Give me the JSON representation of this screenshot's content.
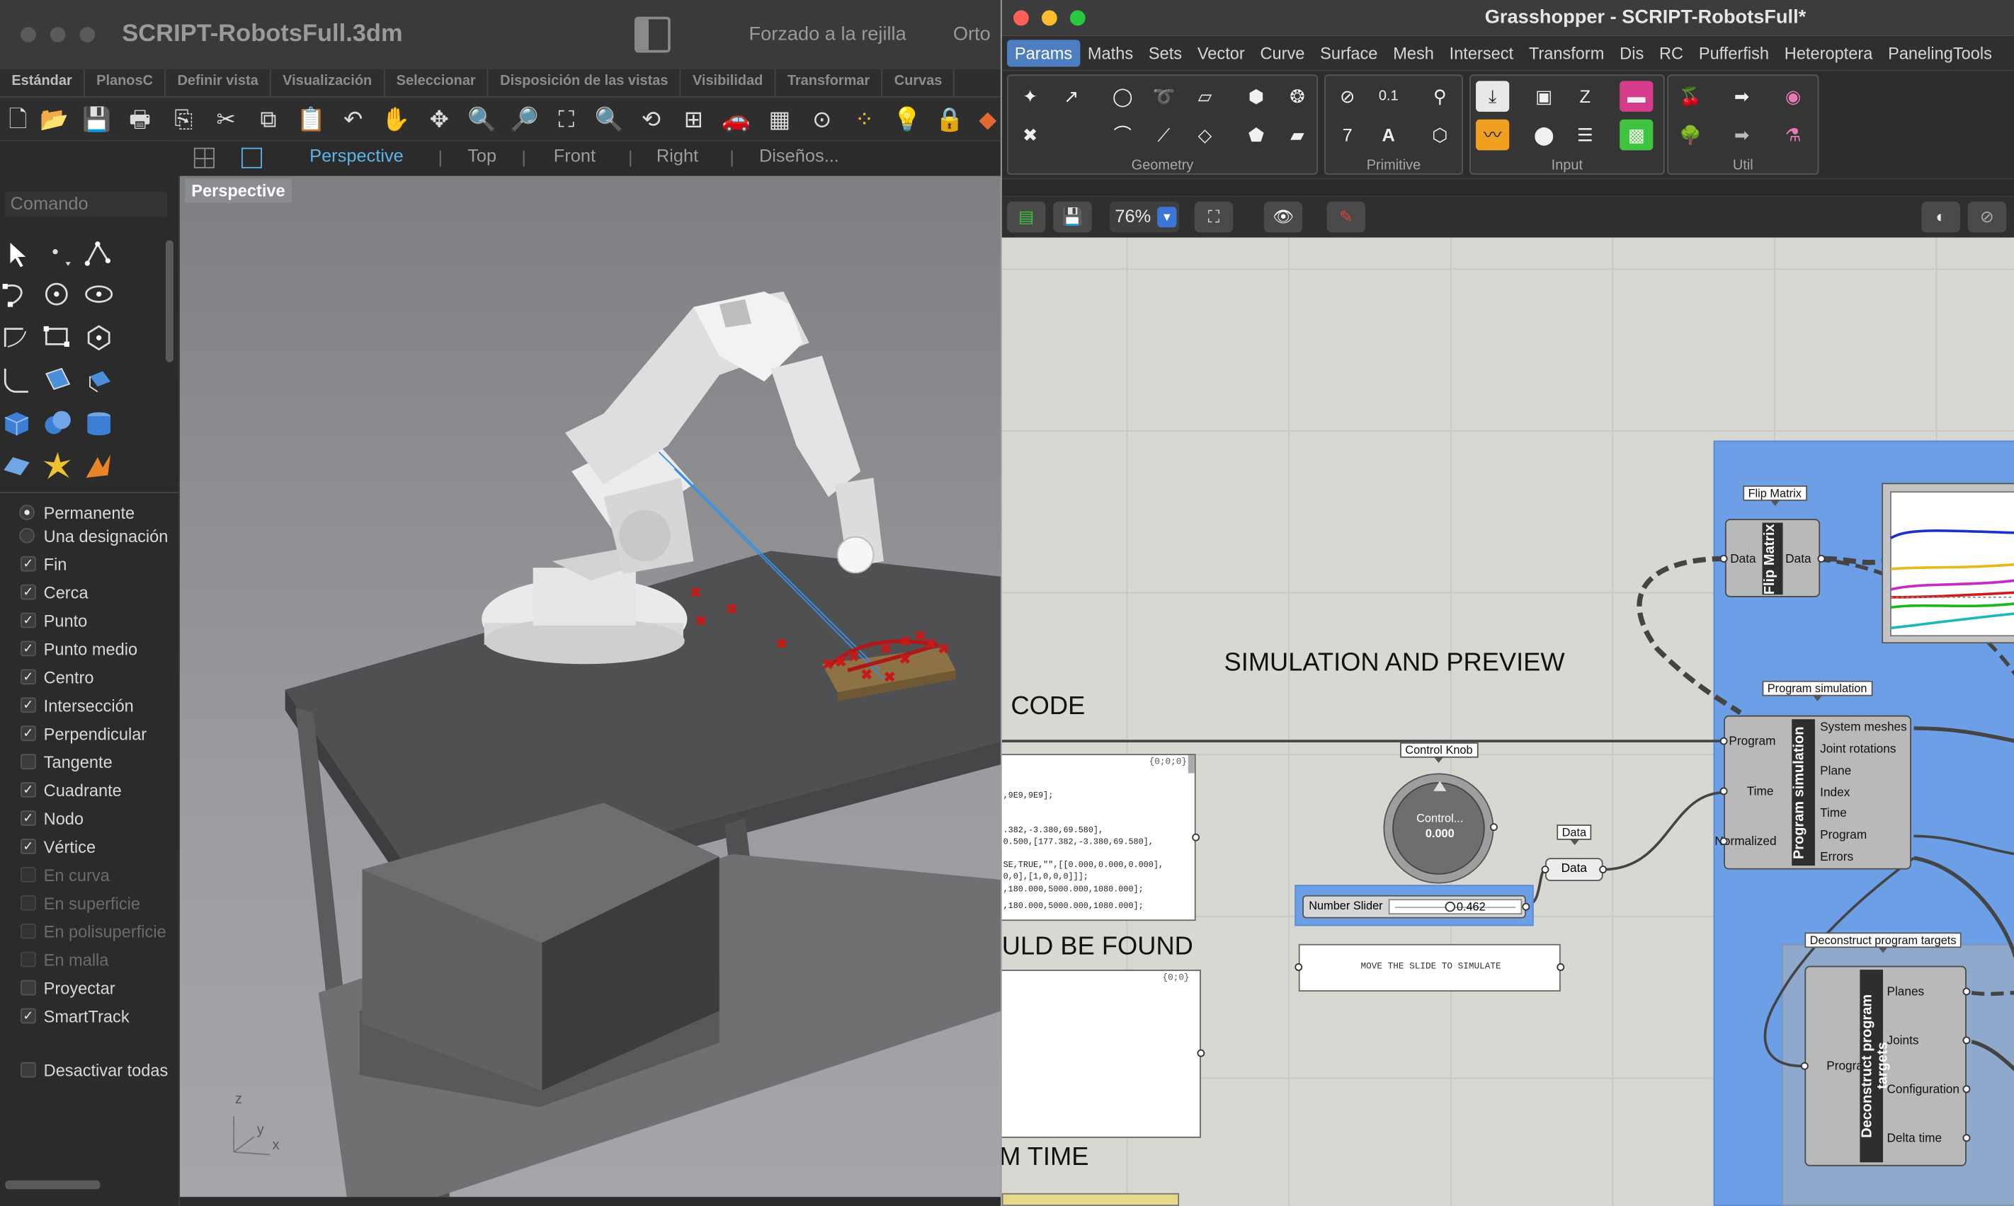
{
  "rhino": {
    "title": "SCRIPT-RobotsFull.3dm",
    "snap_label": "Forzado a la rejilla",
    "ortho_label": "Orto",
    "toolbar_tabs": [
      "Estándar",
      "PlanosC",
      "Definir vista",
      "Visualización",
      "Seleccionar",
      "Disposición de las vistas",
      "Visibilidad",
      "Transformar",
      "Curvas"
    ],
    "view_tabs": [
      "Perspective",
      "Top",
      "Front",
      "Right",
      "Diseños..."
    ],
    "command_placeholder": "Comando",
    "viewport_label": "Perspective",
    "radio_options": [
      {
        "label": "Permanente",
        "selected": true
      },
      {
        "label": "Una designación",
        "selected": false
      }
    ],
    "osnaps": [
      {
        "label": "Fin",
        "checked": true,
        "enabled": true
      },
      {
        "label": "Cerca",
        "checked": true,
        "enabled": true
      },
      {
        "label": "Punto",
        "checked": true,
        "enabled": true
      },
      {
        "label": "Punto medio",
        "checked": true,
        "enabled": true
      },
      {
        "label": "Centro",
        "checked": true,
        "enabled": true
      },
      {
        "label": "Intersección",
        "checked": true,
        "enabled": true
      },
      {
        "label": "Perpendicular",
        "checked": true,
        "enabled": true
      },
      {
        "label": "Tangente",
        "checked": false,
        "enabled": true
      },
      {
        "label": "Cuadrante",
        "checked": true,
        "enabled": true
      },
      {
        "label": "Nodo",
        "checked": true,
        "enabled": true
      },
      {
        "label": "Vértice",
        "checked": true,
        "enabled": true
      },
      {
        "label": "En curva",
        "checked": false,
        "enabled": false
      },
      {
        "label": "En superficie",
        "checked": false,
        "enabled": false
      },
      {
        "label": "En polisuperficie",
        "checked": false,
        "enabled": false
      },
      {
        "label": "En malla",
        "checked": false,
        "enabled": false
      },
      {
        "label": "Proyectar",
        "checked": false,
        "enabled": true
      },
      {
        "label": "SmartTrack",
        "checked": true,
        "enabled": true
      }
    ],
    "disable_all_label": "Desactivar todas",
    "axis_labels": {
      "z": "z",
      "y": "y",
      "x": "x"
    }
  },
  "grasshopper": {
    "title": "Grasshopper - SCRIPT-RobotsFull*",
    "menus": [
      "Params",
      "Maths",
      "Sets",
      "Vector",
      "Curve",
      "Surface",
      "Mesh",
      "Intersect",
      "Transform",
      "Dis",
      "RC",
      "Pufferfish",
      "Heteroptera",
      "PanelingTools"
    ],
    "active_menu": "Params",
    "ribbon_groups": [
      "Geometry",
      "Primitive",
      "Input",
      "Util"
    ],
    "zoom": "76%",
    "canvas": {
      "heading_simulation": "SIMULATION AND PREVIEW",
      "heading_code": "CODE",
      "heading_found": "ULD BE FOUND",
      "heading_time": "M TIME",
      "flip_matrix": {
        "tag": "Flip Matrix",
        "title": "Flip Matrix",
        "input": "Data",
        "output": "Data"
      },
      "program_simulation": {
        "tag": "Program simulation",
        "title": "Program simulation",
        "inputs": [
          "Program",
          "Time",
          "Normalized"
        ],
        "outputs": [
          "System meshes",
          "Joint rotations",
          "Plane",
          "Index",
          "Time",
          "Program",
          "Errors"
        ]
      },
      "deconstruct": {
        "tag": "Deconstruct program targets",
        "title": "Deconstruct program targets",
        "inputs": [
          "Program"
        ],
        "outputs": [
          "Planes",
          "Joints",
          "Configuration",
          "Delta time"
        ]
      },
      "control_knob": {
        "tag": "Control Knob",
        "label": "Control...",
        "value": "0.000"
      },
      "data_param": {
        "tag": "Data",
        "label": "Data"
      },
      "number_slider": {
        "label": "Number Slider",
        "value": "0.462"
      },
      "move_panel_text": "MOVE THE SLIDE TO SIMULATE",
      "code_panel": {
        "path": "{0;0;0}",
        "lines": [
          ",9E9,9E9];",
          ".382,-3.380,69.580],",
          "0.500,[177.382,-3.380,69.580],",
          "SE,TRUE,\"\",[[0.000,0.000,0.000],",
          "0,0],[1,0,0,0]]];",
          ",180.000,5000.000,1080.000];",
          ",180.000,5000.000,1080.000];"
        ]
      },
      "empty_panel": {
        "path": "{0;0}"
      }
    }
  }
}
